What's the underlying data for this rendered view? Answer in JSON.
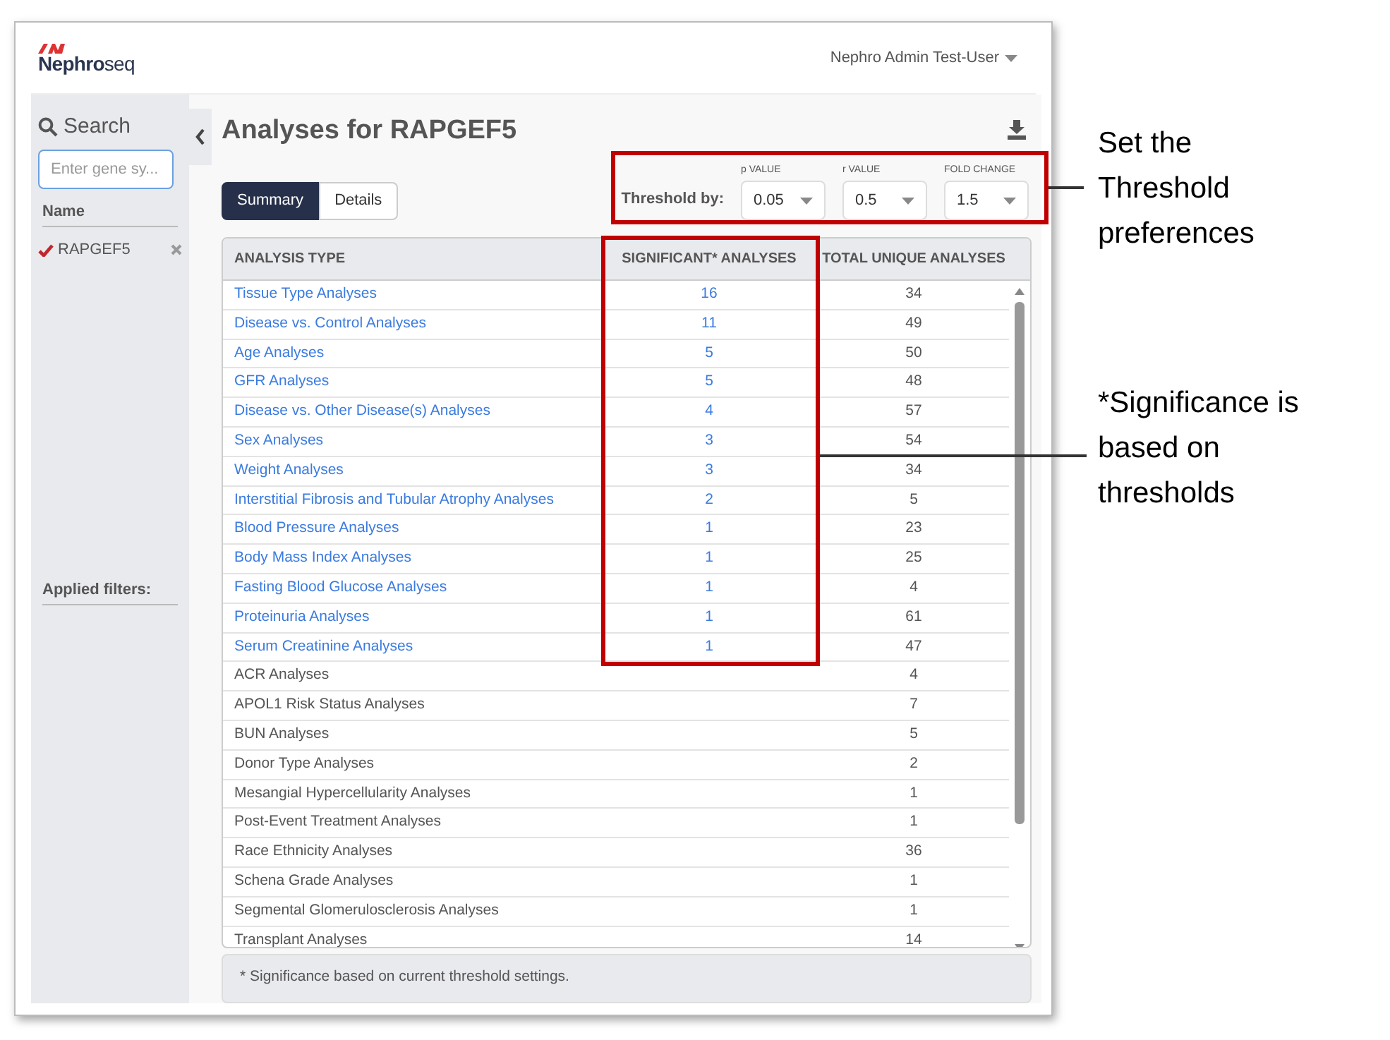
{
  "header": {
    "logo": "**Nephro**seq",
    "user_menu": "Nephro Admin Test-User"
  },
  "sidebar": {
    "search_title": "Search",
    "search_field": {
      "placeholder": "Enter gene sy..."
    },
    "list_heading": "Name",
    "genes": [
      {
        "name": "RAPGEF5",
        "checked": true
      }
    ],
    "filters_heading": "Applied filters:"
  },
  "main": {
    "title": "Analyses for RAPGEF5",
    "tabs": [
      {
        "label": "Summary",
        "selected": true
      },
      {
        "label": "Details",
        "selected": false
      }
    ],
    "threshold": {
      "label": "Threshold by:",
      "selects": [
        {
          "caption": "p VALUE",
          "value": "0.05"
        },
        {
          "caption": "r VALUE",
          "value": "0.5"
        },
        {
          "caption": "FOLD CHANGE",
          "value": "1.5"
        }
      ]
    },
    "table": {
      "columns": [
        "ANALYSIS TYPE",
        "SIGNIFICANT* ANALYSES",
        "TOTAL UNIQUE ANALYSES"
      ],
      "rows": [
        {
          "kind": "link",
          "type": "Tissue Type Analyses",
          "significant": "16",
          "total": "34"
        },
        {
          "kind": "link",
          "type": "Disease vs. Control Analyses",
          "significant": "11",
          "total": "49"
        },
        {
          "kind": "link",
          "type": "Age Analyses",
          "significant": "5",
          "total": "50"
        },
        {
          "kind": "link",
          "type": "GFR Analyses",
          "significant": "5",
          "total": "48"
        },
        {
          "kind": "link",
          "type": "Disease vs. Other Disease(s) Analyses",
          "significant": "4",
          "total": "57"
        },
        {
          "kind": "link",
          "type": "Sex Analyses",
          "significant": "3",
          "total": "54"
        },
        {
          "kind": "link",
          "type": "Weight Analyses",
          "significant": "3",
          "total": "34"
        },
        {
          "kind": "link",
          "type": "Interstitial Fibrosis and Tubular Atrophy Analyses",
          "significant": "2",
          "total": "5"
        },
        {
          "kind": "link",
          "type": "Blood Pressure Analyses",
          "significant": "1",
          "total": "23"
        },
        {
          "kind": "link",
          "type": "Body Mass Index Analyses",
          "significant": "1",
          "total": "25"
        },
        {
          "kind": "link",
          "type": "Fasting Blood Glucose Analyses",
          "significant": "1",
          "total": "4"
        },
        {
          "kind": "link",
          "type": "Proteinuria Analyses",
          "significant": "1",
          "total": "61"
        },
        {
          "kind": "link",
          "type": "Serum Creatinine Analyses",
          "significant": "1",
          "total": "47"
        },
        {
          "kind": "plain",
          "type": "ACR Analyses",
          "total": "4"
        },
        {
          "kind": "plain",
          "type": "APOL1 Risk Status Analyses",
          "total": "7"
        },
        {
          "kind": "plain",
          "type": "BUN Analyses",
          "total": "5"
        },
        {
          "kind": "plain",
          "type": "Donor Type Analyses",
          "total": "2"
        },
        {
          "kind": "plain",
          "type": "Mesangial Hypercellularity Analyses",
          "total": "1"
        },
        {
          "kind": "plain",
          "type": "Post-Event Treatment Analyses",
          "total": "1"
        },
        {
          "kind": "plain",
          "type": "Race Ethnicity Analyses",
          "total": "36"
        },
        {
          "kind": "plain",
          "type": "Schena Grade Analyses",
          "total": "1"
        },
        {
          "kind": "plain",
          "type": "Segmental Glomerulosclerosis Analyses",
          "total": "1"
        },
        {
          "kind": "plain",
          "type": "Transplant Analyses",
          "total": "14"
        }
      ],
      "footnote": "* Significance based on current threshold settings."
    }
  },
  "annotations": [
    {
      "text": "Set the Threshold preferences"
    },
    {
      "text": "*Significance is based on thresholds"
    }
  ]
}
